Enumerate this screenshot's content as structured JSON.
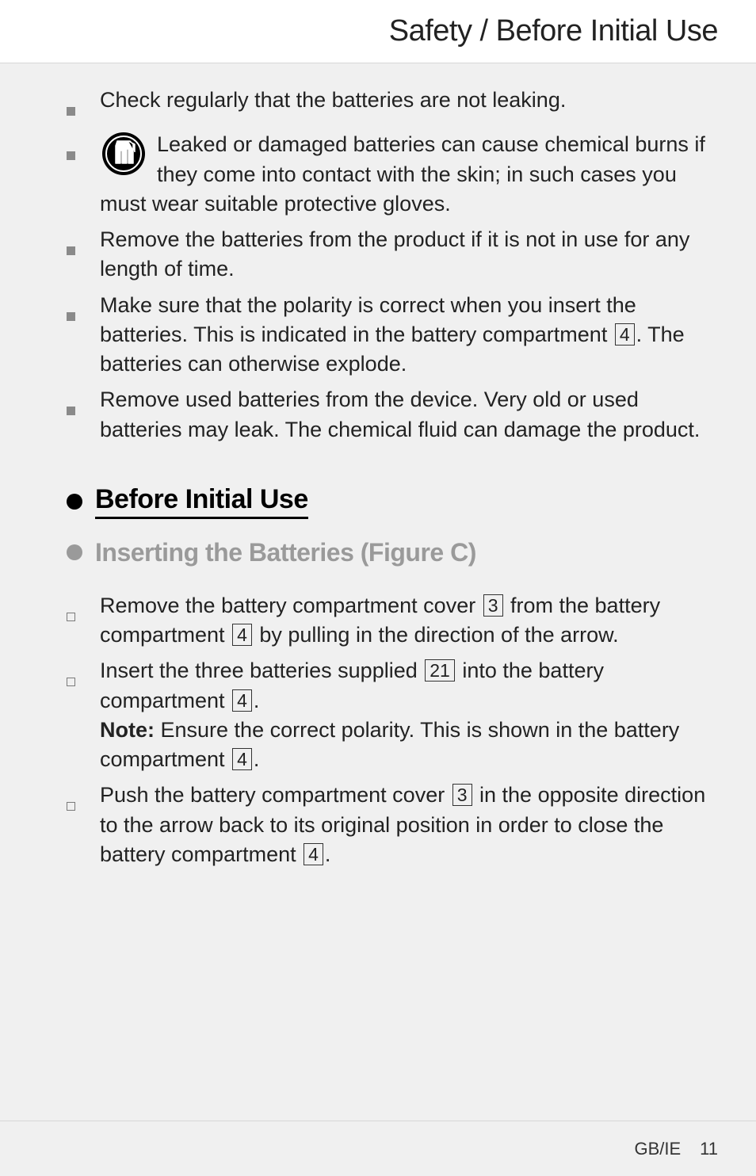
{
  "header": {
    "title": "Safety / Before Initial Use"
  },
  "bullets_top": [
    {
      "text": "Check regularly that the batteries are not leaking."
    },
    {
      "text_with_icon": "Leaked or damaged batteries can cause chemical burns if they come into contact with the skin; in such cases you must wear suitable protective gloves."
    },
    {
      "text": "Remove the batteries from the product if it is not in use for any length of time."
    },
    {
      "pre": "Make sure that the polarity is correct when you insert the batteries. This is indicated in the battery compartment ",
      "ref1": "4",
      "post": ". The batteries can otherwise explode."
    },
    {
      "text": "Remove used batteries from the device. Very old or used batteries may leak. The chemical fluid can damage the product."
    }
  ],
  "section": {
    "title": "Before Initial Use"
  },
  "subsection": {
    "title": "Inserting the Batteries (Figure C)"
  },
  "steps": [
    {
      "parts": [
        {
          "t": "Remove the battery compartment cover "
        },
        {
          "ref": "3"
        },
        {
          "t": " from the battery compartment "
        },
        {
          "ref": "4"
        },
        {
          "t": " by pulling in the direction of the arrow."
        }
      ]
    },
    {
      "parts": [
        {
          "t": "Insert the three batteries supplied "
        },
        {
          "ref": "21"
        },
        {
          "t": " into the battery compartment "
        },
        {
          "ref": "4"
        },
        {
          "t": "."
        }
      ],
      "note_pre": "Note:",
      "note_parts": [
        {
          "t": " Ensure the correct polarity. This is shown in the battery compartment "
        },
        {
          "ref": "4"
        },
        {
          "t": "."
        }
      ]
    },
    {
      "parts": [
        {
          "t": "Push the battery compartment cover "
        },
        {
          "ref": "3"
        },
        {
          "t": " in the opposite direction to the arrow back to its original position in order to close the battery compartment "
        },
        {
          "ref": "4"
        },
        {
          "t": "."
        }
      ]
    }
  ],
  "footer": {
    "region": "GB/IE",
    "page": "11"
  }
}
